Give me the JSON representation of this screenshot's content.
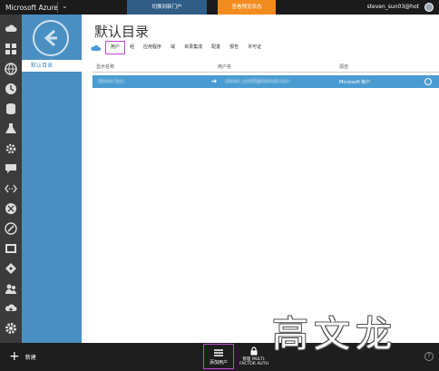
{
  "topbar": {
    "brand": "Microsoft Azure",
    "portal_link": "切换到新门户",
    "preview_link": "查看预览状态",
    "user": "steven_sun03@hot"
  },
  "rail_icons": [
    "cloud-icon",
    "grid-icon",
    "globe-icon",
    "clock-icon",
    "database-icon",
    "flask-icon",
    "gear-network-icon",
    "chat-icon",
    "code-icon",
    "hdinsight-icon",
    "link-icon",
    "media-icon",
    "flow-icon",
    "people-icon",
    "cloud-upload-icon",
    "settings-icon"
  ],
  "subnav": {
    "item": "默认目录"
  },
  "page": {
    "title": "默认目录",
    "tabs": [
      "用户",
      "组",
      "应用程序",
      "域",
      "目录集成",
      "配置",
      "报告",
      "许可证"
    ]
  },
  "table": {
    "headers": [
      "显示名称",
      "用户名",
      "源自"
    ],
    "rows": [
      {
        "display_name": "Steven Sun",
        "user_name": "steven_sun03@hotmail.com",
        "source": "Microsoft 帐户"
      }
    ]
  },
  "commands": {
    "new": "新建",
    "add_user": "添加用户",
    "mfa_line1": "管理 MULTI-",
    "mfa_line2": "FACTOR AUTH"
  },
  "watermark": "高文龙",
  "colors": {
    "accent": "#4a9bd1",
    "highlight": "#c247d5",
    "preview": "#f28c1e"
  }
}
